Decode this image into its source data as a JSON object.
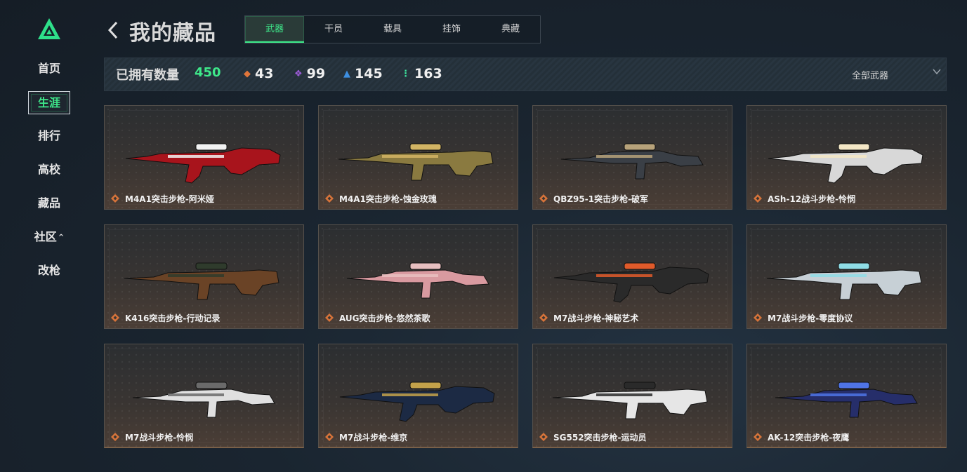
{
  "nav": {
    "items": [
      {
        "label": "首页"
      },
      {
        "label": "生涯"
      },
      {
        "label": "排行"
      },
      {
        "label": "高校"
      },
      {
        "label": "藏品"
      },
      {
        "label": "社区"
      },
      {
        "label": "改枪"
      }
    ],
    "active_index": 1
  },
  "header": {
    "title": "我的藏品",
    "tabs": [
      {
        "label": "武器"
      },
      {
        "label": "干员"
      },
      {
        "label": "载具"
      },
      {
        "label": "挂饰"
      },
      {
        "label": "典藏"
      }
    ],
    "active_tab": 0
  },
  "stats": {
    "owned_label": "已拥有数量",
    "owned_count": "450",
    "rarities": [
      {
        "count": "43",
        "color": "#e0753a",
        "icon": "orange-diamond-icon"
      },
      {
        "count": "99",
        "color": "#9b5bd6",
        "icon": "purple-diamond-icon"
      },
      {
        "count": "145",
        "color": "#3d8fe0",
        "icon": "blue-chevron-icon"
      },
      {
        "count": "163",
        "color": "#3ee8a0",
        "icon": "green-dots-icon"
      }
    ],
    "filter_label": "全部武器"
  },
  "weapons": [
    {
      "name": "M4A1突击步枪-阿米娅",
      "color": "#a8141c",
      "accent": "#f2f2f2"
    },
    {
      "name": "M4A1突击步枪-蚀金玫瑰",
      "color": "#8a7a40",
      "accent": "#d2b464"
    },
    {
      "name": "QBZ95-1突击步枪-破军",
      "color": "#3a3f46",
      "accent": "#b7a27a"
    },
    {
      "name": "ASh-12战斗步枪-怜悯",
      "color": "#d8d8d8",
      "accent": "#f4e7c6"
    },
    {
      "name": "K416突击步枪-行动记录",
      "color": "#6a4326",
      "accent": "#2f3b2c"
    },
    {
      "name": "AUG突击步枪-悠然茶歌",
      "color": "#d99aa0",
      "accent": "#e7bfc0"
    },
    {
      "name": "M7战斗步枪-神秘艺术",
      "color": "#2a2a2a",
      "accent": "#e05a2a"
    },
    {
      "name": "M7战斗步枪-零度协议",
      "color": "#c7d0d6",
      "accent": "#8fdde6"
    },
    {
      "name": "M7战斗步枪-怜悯",
      "color": "#e0e0e0",
      "accent": "#6a6a6a"
    },
    {
      "name": "M7战斗步枪-维京",
      "color": "#1c2a44",
      "accent": "#c4a24a"
    },
    {
      "name": "SG552突击步枪-运动员",
      "color": "#e6e6e6",
      "accent": "#2a2a2a"
    },
    {
      "name": "AK-12突击步枪-夜鹰",
      "color": "#262e6a",
      "accent": "#4f74e6"
    }
  ],
  "card_gem_color": "#d8743a"
}
